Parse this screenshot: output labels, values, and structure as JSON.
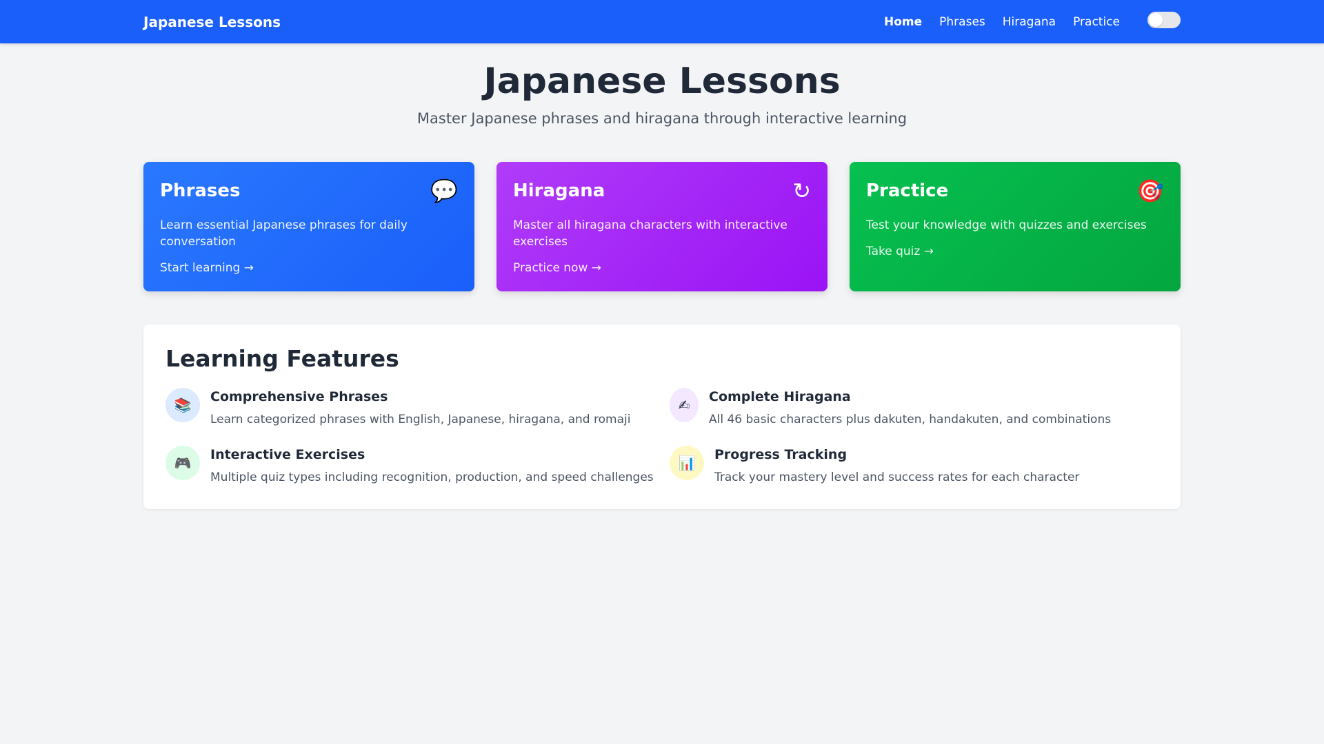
{
  "nav": {
    "brand": "Japanese Lessons",
    "links": [
      "Home",
      "Phrases",
      "Hiragana",
      "Practice"
    ]
  },
  "hero": {
    "title": "Japanese Lessons",
    "subtitle": "Master Japanese phrases and hiragana through interactive learning"
  },
  "cards": [
    {
      "title": "Phrases",
      "icon": "💬",
      "icon_name": "speech-bubble-icon",
      "description": "Learn essential Japanese phrases for daily conversation",
      "cta": "Start learning →",
      "color": "#1a5ffa"
    },
    {
      "title": "Hiragana",
      "icon": "↻",
      "icon_name": "hiragana-character-icon",
      "description": "Master all hiragana characters with interactive exercises",
      "cta": "Practice now →",
      "color": "#9a13f5"
    },
    {
      "title": "Practice",
      "icon": "🎯",
      "icon_name": "target-icon",
      "description": "Test your knowledge with quizzes and exercises",
      "cta": "Take quiz →",
      "color": "#04a63f"
    }
  ],
  "features": {
    "title": "Learning Features",
    "items": [
      {
        "title": "Comprehensive Phrases",
        "description": "Learn categorized phrases with English, Japanese, hiragana, and romaji",
        "icon": "📚",
        "icon_name": "books-icon",
        "icon_bg": "#dbeafe"
      },
      {
        "title": "Complete Hiragana",
        "description": "All 46 basic characters plus dakuten, handakuten, and combinations",
        "icon": "✍",
        "icon_name": "writing-hand-icon",
        "icon_bg": "#f3e8ff"
      },
      {
        "title": "Interactive Exercises",
        "description": "Multiple quiz types including recognition, production, and speed challenges",
        "icon": "🎮",
        "icon_name": "game-controller-icon",
        "icon_bg": "#dcfce7"
      },
      {
        "title": "Progress Tracking",
        "description": "Track your mastery level and success rates for each character",
        "icon": "📊",
        "icon_name": "bar-chart-icon",
        "icon_bg": "#fef9c3"
      }
    ]
  }
}
